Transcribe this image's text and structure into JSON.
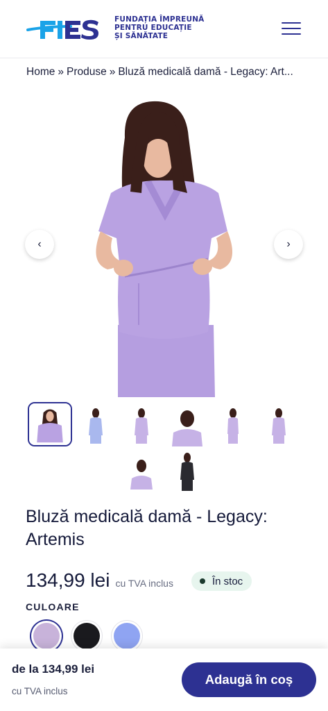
{
  "brand": {
    "logo_text": "FIES",
    "tagline_lines": [
      "FUNDAȚIA ÎMPREUNĂ",
      "PENTRU EDUCAȚIE",
      "ȘI SĂNĂTATE"
    ]
  },
  "header": {
    "menu_icon": "hamburger-menu-icon"
  },
  "breadcrumb": {
    "items": [
      "Home",
      "Produse",
      "Bluză medicală damă - Legacy: Art..."
    ],
    "separator": "»"
  },
  "gallery": {
    "prev_icon": "chevron-left-icon",
    "next_icon": "chevron-right-icon",
    "prev_glyph": "‹",
    "next_glyph": "›"
  },
  "product": {
    "title": "Bluză medicală damă - Legacy: Artemis",
    "price": "134,99 lei",
    "vat_note": "cu TVA inclus",
    "stock": "În stoc",
    "color_label": "CULOARE",
    "colors": [
      {
        "hex": "#c8b3da"
      },
      {
        "hex": "#1a1a1e"
      },
      {
        "hex": "#8fa4f2"
      }
    ]
  },
  "sticky_bar": {
    "price": "de la 134,99 lei",
    "vat_note": "cu TVA inclus",
    "add_to_cart": "Adaugă în coș"
  },
  "theme": {
    "primary": "#2d3192",
    "accent_blue": "#1aa3e8",
    "scrub_lavender": "#b59ee0",
    "stock_bg": "#e7f5ee"
  }
}
